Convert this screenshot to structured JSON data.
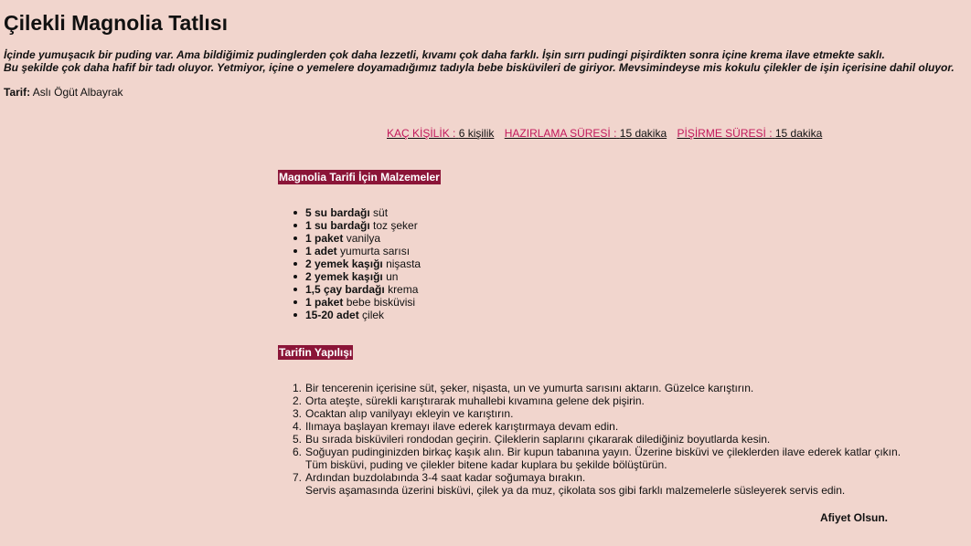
{
  "recipe": {
    "title": "Çilekli Magnolia Tatlısı",
    "intro_line1": "İçinde yumuşacık bir puding var. Ama bildiğimiz pudinglerden çok daha lezzetli, kıvamı çok daha farklı. İşin sırrı pudingi pişirdikten sonra içine krema ilave etmekte saklı.",
    "intro_line2": "Bu şekilde çok daha hafif bir tadı oluyor. Yetmiyor, içine o yemelere doyamadığımız tadıyla bebe bisküvileri de giriyor. Mevsimindeyse mis kokulu çilekler de işin içerisine dahil oluyor.",
    "author_label": "Tarif:",
    "author_name": "Aslı Ögüt Albayrak"
  },
  "meta": [
    {
      "key": "KAÇ KİŞİLİK :",
      "value": "6 kişilik"
    },
    {
      "key": "HAZIRLAMA SÜRESİ :",
      "value": "15 dakika"
    },
    {
      "key": "PİŞİRME SÜRESİ :",
      "value": "15 dakika"
    }
  ],
  "ingredients_heading": "Magnolia Tarifi İçin Malzemeler",
  "ingredients": [
    {
      "qty": "5 su bardağı",
      "item": "süt"
    },
    {
      "qty": "1 su bardağı",
      "item": "toz şeker"
    },
    {
      "qty": "1 paket",
      "item": "vanilya"
    },
    {
      "qty": "1 adet",
      "item": "yumurta sarısı"
    },
    {
      "qty": "2 yemek kaşığı",
      "item": "nişasta"
    },
    {
      "qty": "2 yemek kaşığı",
      "item": "un"
    },
    {
      "qty": "1,5 çay bardağı",
      "item": "krema"
    },
    {
      "qty": "1 paket",
      "item": "bebe bisküvisi"
    },
    {
      "qty": "15-20 adet",
      "item": "çilek"
    }
  ],
  "steps_heading": "Tarifin Yapılışı",
  "steps": [
    {
      "num": "1.",
      "lines": [
        "Bir tencerenin içerisine süt, şeker, nişasta, un ve yumurta sarısını aktarın. Güzelce karıştırın."
      ]
    },
    {
      "num": "2.",
      "lines": [
        "Orta ateşte, sürekli karıştırarak muhallebi kıvamına gelene dek pişirin."
      ]
    },
    {
      "num": "3.",
      "lines": [
        "Ocaktan alıp vanilyayı ekleyin ve karıştırın."
      ]
    },
    {
      "num": "4.",
      "lines": [
        "Ilımaya başlayan kremayı ilave ederek karıştırmaya devam edin."
      ]
    },
    {
      "num": "5.",
      "lines": [
        "Bu sırada bisküvileri rondodan geçirin. Çileklerin saplarını çıkararak dilediğiniz boyutlarda kesin."
      ]
    },
    {
      "num": "6.",
      "lines": [
        "Soğuyan pudinginizden birkaç kaşık alın. Bir kupun tabanına yayın. Üzerine bisküvi ve çileklerden ilave ederek katlar çıkın.",
        "Tüm bisküvi, puding ve çilekler bitene kadar kuplara bu şekilde bölüştürün."
      ]
    },
    {
      "num": "7.",
      "lines": [
        "Ardından buzdolabında 3-4 saat kadar soğumaya bırakın.",
        "Servis aşamasında üzerini bisküvi, çilek ya da muz, çikolata sos gibi farklı malzemelerle süsleyerek servis edin."
      ]
    }
  ],
  "closing": "Afiyet Olsun.",
  "colors": {
    "background": "#f1d5cd",
    "heading_bg": "#8b1538",
    "link": "#c2185b"
  }
}
